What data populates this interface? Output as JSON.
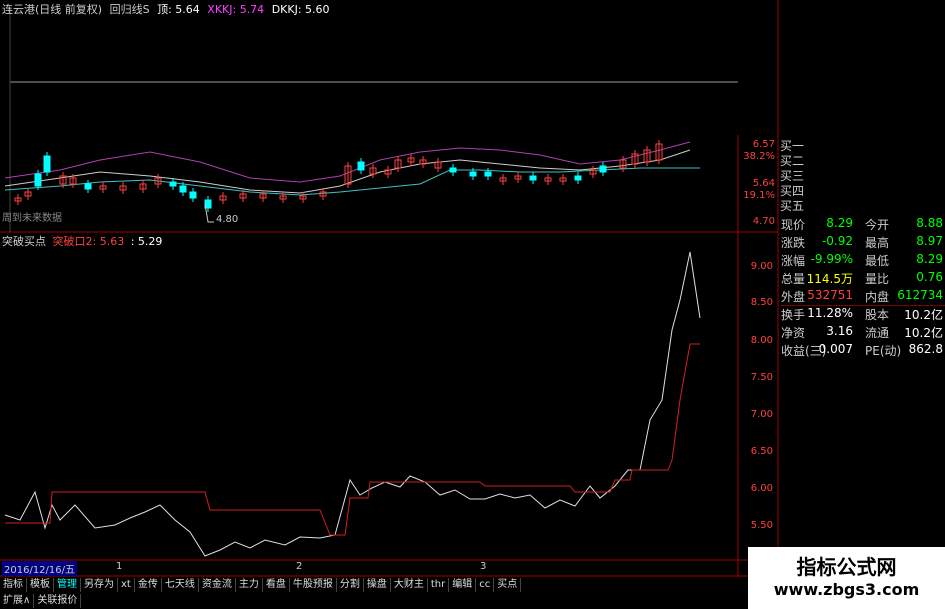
{
  "header": {
    "name": "连云港(日线 前复权)",
    "indicator": "回归线S",
    "items": [
      {
        "label": "顶: 5.64",
        "color": "#ffffff"
      },
      {
        "label": "XKKJ: 5.74",
        "color": "#ff40ff"
      },
      {
        "label": "DKKJ: 5.60",
        "color": "#ffffff"
      }
    ],
    "future_note": "周到未来数据",
    "low_mark": "4.80"
  },
  "upper_axis": {
    "ticks": [
      "6.57",
      "38.2%",
      "5.64",
      "19.1%",
      "4.70"
    ],
    "ticks_color": [
      "#ff4040",
      "#ff4040",
      "#ff4040",
      "#ff4040",
      "#ff4040"
    ]
  },
  "bid_labels": [
    "买一",
    "买二",
    "买三",
    "买四",
    "买五"
  ],
  "indicator_header": {
    "name": "突破买点",
    "line1_label": "突破口2: 5.63",
    "line2_label": ": 5.29"
  },
  "lower_axis": {
    "ticks": [
      "9.00",
      "8.50",
      "8.00",
      "7.50",
      "7.00",
      "6.50",
      "6.00",
      "5.50"
    ]
  },
  "quote_panel": {
    "rows": [
      {
        "l1": "现价",
        "v1": "8.29",
        "c1": "#00ff00",
        "l2": "今开",
        "v2": "8.88",
        "c2": "#00ff00"
      },
      {
        "l1": "涨跌",
        "v1": "-0.92",
        "c1": "#00ff00",
        "l2": "最高",
        "v2": "8.97",
        "c2": "#00ff00"
      },
      {
        "l1": "涨幅",
        "v1": "-9.99%",
        "c1": "#00ff00",
        "l2": "最低",
        "v2": "8.29",
        "c2": "#00ff00"
      },
      {
        "l1": "总量",
        "v1": "114.5万",
        "c1": "#ffff00",
        "l2": "量比",
        "v2": "0.76",
        "c2": "#00ff00"
      },
      {
        "l1": "外盘",
        "v1": "532751",
        "c1": "#ff4040",
        "l2": "内盘",
        "v2": "612734",
        "c2": "#00ff00"
      },
      {
        "l1": "换手",
        "v1": "11.28%",
        "c1": "#ffffff",
        "l2": "股本",
        "v2": "10.2亿",
        "c2": "#ffffff"
      },
      {
        "l1": "净资",
        "v1": "3.16",
        "c1": "#ffffff",
        "l2": "流通",
        "v2": "10.2亿",
        "c2": "#ffffff"
      },
      {
        "l1": "收益(三)",
        "v1": "0.007",
        "c1": "#ffffff",
        "l2": "PE(动)",
        "v2": "862.8",
        "c2": "#ffffff"
      }
    ]
  },
  "date_bar": {
    "date": "2016/12/16/五",
    "markers": [
      "1",
      "2",
      "3"
    ]
  },
  "toolbar": [
    "指标",
    "模板",
    "管理",
    "另存为",
    "xt",
    "金传",
    "七天线",
    "资金流",
    "主力",
    "看盘",
    "牛股预报",
    "分割",
    "操盘",
    "大财主",
    "thr",
    "编辑",
    "cc",
    "买点"
  ],
  "toolbar_active": "管理",
  "bottom_tabs": [
    "扩展∧",
    "关联报价"
  ],
  "watermark": {
    "line1": "指标公式网",
    "line2": "www.zbgs3.com"
  }
}
